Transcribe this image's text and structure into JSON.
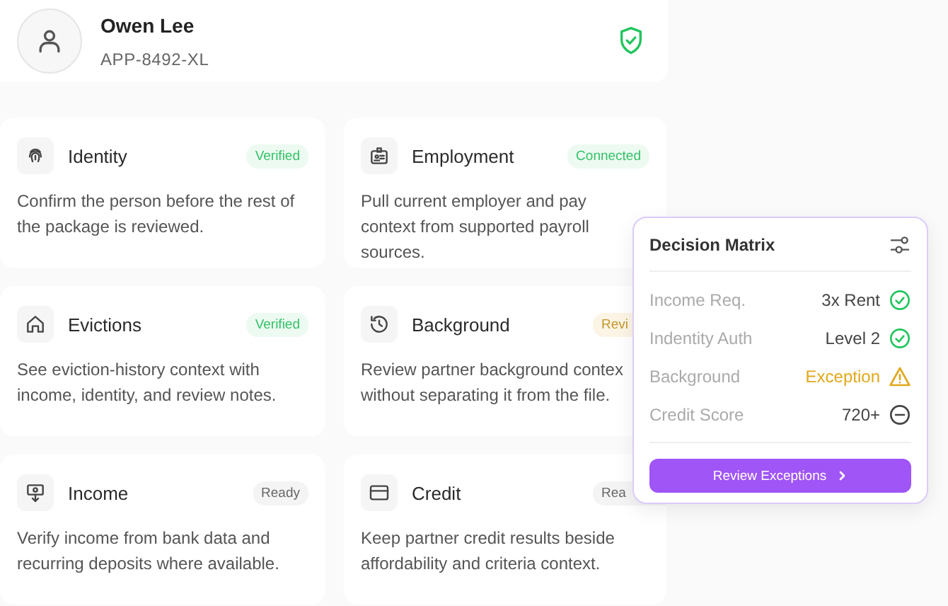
{
  "applicant": {
    "name": "Owen Lee",
    "id": "APP-8492-XL",
    "verified": true
  },
  "cards": [
    {
      "title": "Identity",
      "badge": {
        "text": "Verified",
        "kind": "verified",
        "clipped": false
      },
      "description": "Confirm the person before the rest of\nthe package is reviewed."
    },
    {
      "title": "Employment",
      "badge": {
        "text": "Connected",
        "kind": "verified",
        "clipped": false
      },
      "description": "Pull current employer and pay\ncontext from supported payroll\nsources."
    },
    {
      "title": "Evictions",
      "badge": {
        "text": "Verified",
        "kind": "verified",
        "clipped": false
      },
      "description": "See eviction-history context with\nincome, identity, and review notes."
    },
    {
      "title": "Background",
      "badge": {
        "text": "Revi",
        "kind": "review",
        "clipped": true
      },
      "description": "Review partner background contex\nwithout separating it from the file."
    },
    {
      "title": "Income",
      "badge": {
        "text": "Ready",
        "kind": "ready",
        "clipped": false
      },
      "description": "Verify income from bank data and\nrecurring deposits where available."
    },
    {
      "title": "Credit",
      "badge": {
        "text": "Rea",
        "kind": "ready",
        "clipped": true
      },
      "description": "Keep partner credit results beside\naffordability and criteria context."
    }
  ],
  "decision_matrix": {
    "title": "Decision Matrix",
    "rows": [
      {
        "label": "Income Req.",
        "value": "3x Rent",
        "kind": "ok"
      },
      {
        "label": "Indentity Auth",
        "value": "Level 2",
        "kind": "ok"
      },
      {
        "label": "Background",
        "value": "Exception",
        "kind": "warning"
      },
      {
        "label": "Credit Score",
        "value": "720+",
        "kind": "neutral"
      }
    ],
    "button": "Review Exceptions"
  }
}
